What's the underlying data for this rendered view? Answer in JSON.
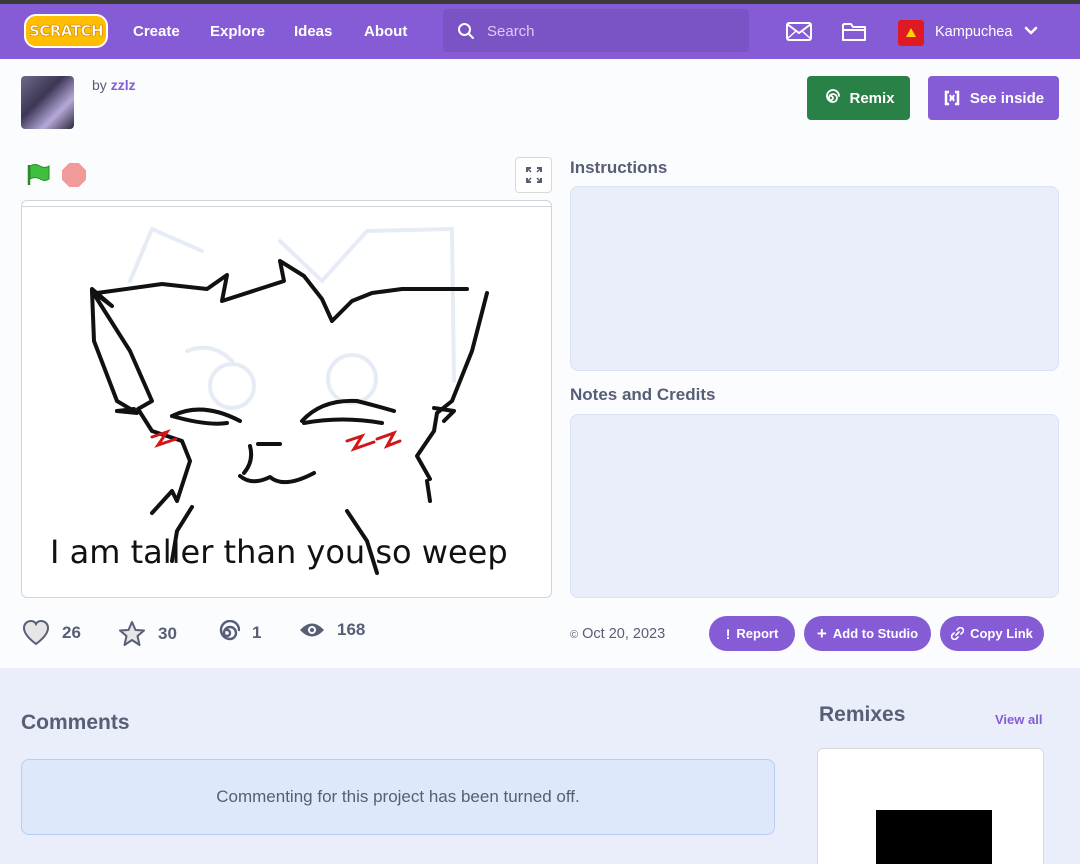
{
  "navbar": {
    "logo_text": "SCRATCH",
    "links": [
      "Create",
      "Explore",
      "Ideas",
      "About"
    ],
    "search_placeholder": "Search",
    "username": "Kampuchea",
    "icons": [
      "messages-icon",
      "my-stuff-folder-icon",
      "chevron-down-icon"
    ]
  },
  "project": {
    "by_label": "by",
    "author": "zzlz",
    "remix_label": "Remix",
    "see_inside_label": "See inside",
    "stage_text": "I am taller than you so weep",
    "instructions_title": "Instructions",
    "notes_title": "Notes and Credits",
    "stats": {
      "loves": "26",
      "favorites": "30",
      "remixes": "1",
      "views": "168"
    },
    "date": "Oct 20, 2023",
    "actions": {
      "report": "Report",
      "add_to_studio": "Add to Studio",
      "copy_link": "Copy Link"
    }
  },
  "comments": {
    "title": "Comments",
    "disabled_message": "Commenting for this project has been turned off."
  },
  "remixes": {
    "title": "Remixes",
    "view_all": "View all"
  },
  "colors": {
    "brand": "#855cd6",
    "remix_green": "#2a8148",
    "text": "#575e75",
    "panel": "#e9eefa"
  }
}
